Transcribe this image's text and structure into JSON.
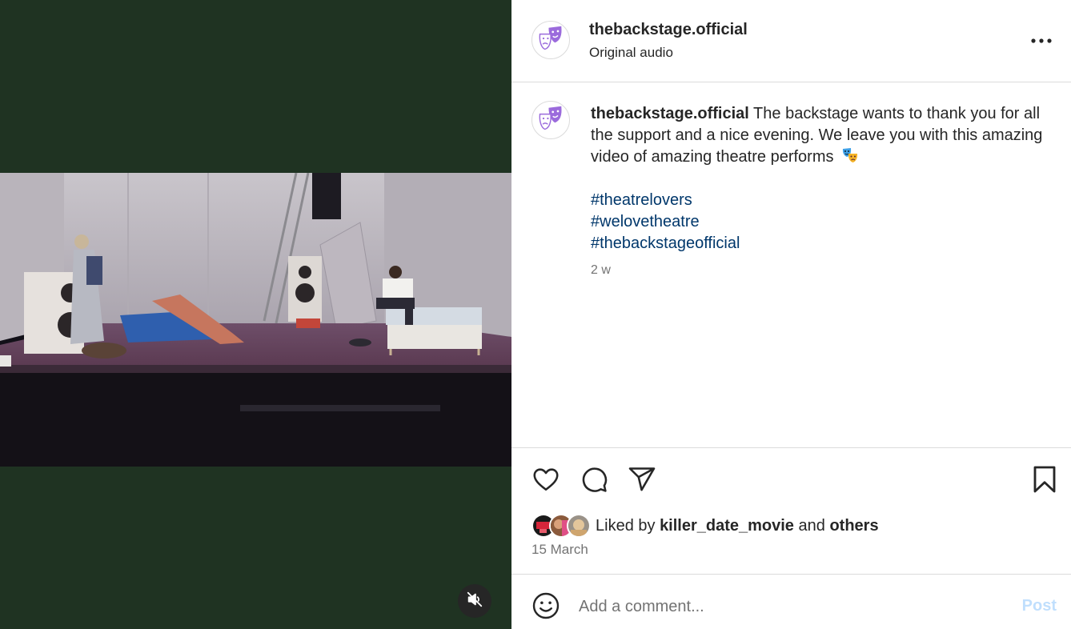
{
  "post": {
    "username": "thebackstage.official",
    "audio": "Original audio",
    "caption_text": "The backstage wants to thank you for all the support and a nice evening. We leave you with this amazing video of amazing theatre performs",
    "hashtags": [
      "#theatrelovers",
      "#welovetheatre",
      "#thebackstageofficial"
    ],
    "time_ago": "2 w",
    "liked_by_prefix": "Liked by",
    "liked_by_user": "killer_date_movie",
    "liked_by_and": "and",
    "liked_by_others": "others",
    "date": "15 March"
  },
  "comment": {
    "placeholder": "Add a comment...",
    "post_label": "Post"
  },
  "icons": {
    "avatar": "theatre-masks-icon",
    "more": "more-options-icon",
    "like": "heart-icon",
    "comment": "comment-bubble-icon",
    "share": "paper-plane-icon",
    "save": "bookmark-icon",
    "emoji": "smiley-icon",
    "mute": "speaker-muted-icon"
  },
  "colors": {
    "media_background": "#1f3322",
    "hashtag": "#00376b",
    "post_button": "#c0dffd",
    "avatar_mask": "#9b6bdc"
  }
}
